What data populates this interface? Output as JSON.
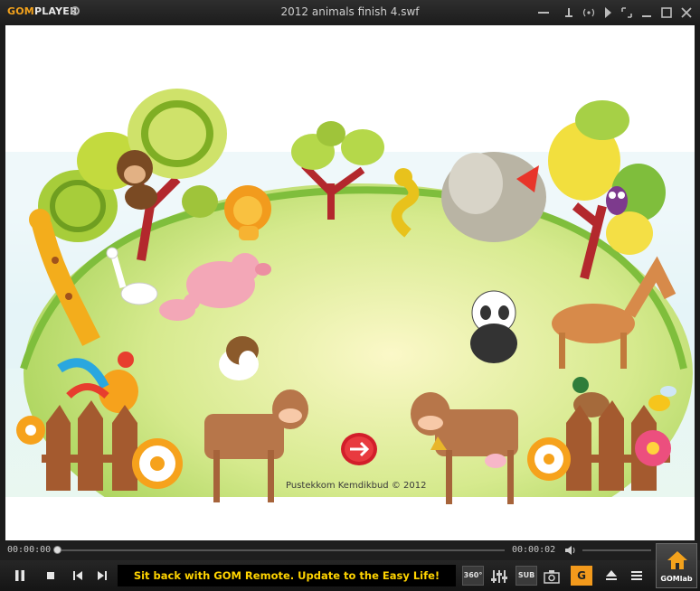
{
  "app": {
    "logo_prefix": "GOM",
    "logo_suffix": "PLAYER",
    "window_title": "2012 animals finish 4.swf"
  },
  "content": {
    "credit": "Pustekkom Kemdikbud © 2012"
  },
  "player": {
    "time_current": "00:00:00",
    "time_total": "00:00:02",
    "marquee": "Sit back with GOM Remote. Update to the Easy Life!",
    "btn_360": "360°",
    "btn_sub": "SUB",
    "btn_gom": "G",
    "gomlab_label": "GOMlab"
  },
  "colors": {
    "brand_orange": "#f3a21c",
    "marquee_yellow": "#ffd400",
    "progress_red": "#e83020"
  }
}
